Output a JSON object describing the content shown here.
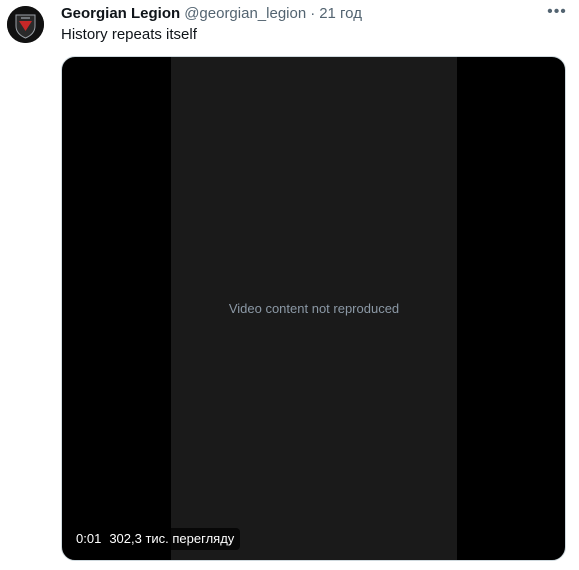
{
  "tweet": {
    "display_name": "Georgian Legion",
    "handle": "@georgian_legion",
    "separator": "·",
    "timestamp": "21 год",
    "text": "History repeats itself",
    "more_icon": "more-horizontal-icon"
  },
  "video": {
    "elapsed": "0:01",
    "views": "302,3 тис. перегляду",
    "placeholder": "Video content not reproduced"
  },
  "colors": {
    "text_primary": "#0f1419",
    "text_secondary": "#536471",
    "media_background": "#000000"
  }
}
